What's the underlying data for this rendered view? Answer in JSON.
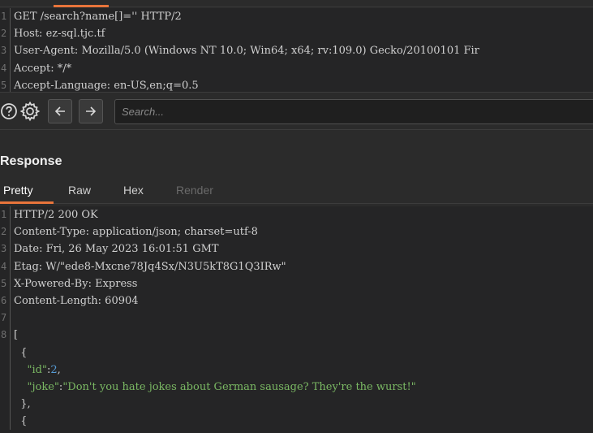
{
  "request": {
    "lines": [
      {
        "n": "1",
        "segments": [
          {
            "t": "GET /search?name[]='' HTTP/2",
            "c": ""
          }
        ]
      },
      {
        "n": "2",
        "segments": [
          {
            "t": "Host: ez-sql.tjc.tf",
            "c": ""
          }
        ]
      },
      {
        "n": "3",
        "segments": [
          {
            "t": "User-Agent: Mozilla/5.0 (Windows NT 10.0; Win64; x64; rv:109.0) Gecko/20100101 Fir",
            "c": ""
          }
        ]
      },
      {
        "n": "4",
        "segments": [
          {
            "t": "Accept: */*",
            "c": ""
          }
        ]
      },
      {
        "n": "5",
        "segments": [
          {
            "t": "Accept-Language: en-US,en;q=0.5",
            "c": ""
          }
        ]
      }
    ]
  },
  "toolbar": {
    "search_placeholder": "Search..."
  },
  "response": {
    "title": "Response",
    "tabs": [
      {
        "label": "Pretty",
        "state": "active"
      },
      {
        "label": "Raw",
        "state": "normal"
      },
      {
        "label": "Hex",
        "state": "normal"
      },
      {
        "label": "Render",
        "state": "disabled"
      }
    ],
    "lines": [
      {
        "n": "1",
        "segments": [
          {
            "t": "HTTP/2 200 OK",
            "c": ""
          }
        ]
      },
      {
        "n": "2",
        "segments": [
          {
            "t": "Content-Type: application/json; charset=utf-8",
            "c": ""
          }
        ]
      },
      {
        "n": "3",
        "segments": [
          {
            "t": "Date: Fri, 26 May 2023 16:01:51 GMT",
            "c": ""
          }
        ]
      },
      {
        "n": "4",
        "segments": [
          {
            "t": "Etag: W/\"ede8-Mxcne78Jq4Sx/N3U5kT8G1Q3IRw\"",
            "c": ""
          }
        ]
      },
      {
        "n": "5",
        "segments": [
          {
            "t": "X-Powered-By: Express",
            "c": ""
          }
        ]
      },
      {
        "n": "6",
        "segments": [
          {
            "t": "Content-Length: 60904",
            "c": ""
          }
        ]
      },
      {
        "n": "7",
        "segments": []
      },
      {
        "n": "8",
        "segments": [
          {
            "t": "[",
            "c": ""
          }
        ]
      },
      {
        "n": "",
        "segments": [
          {
            "t": "  {",
            "c": ""
          }
        ]
      },
      {
        "n": "",
        "segments": [
          {
            "t": "    ",
            "c": ""
          },
          {
            "t": "\"id\"",
            "c": "c-green"
          },
          {
            "t": ":",
            "c": ""
          },
          {
            "t": "2",
            "c": "c-blue"
          },
          {
            "t": ",",
            "c": ""
          }
        ]
      },
      {
        "n": "",
        "segments": [
          {
            "t": "    ",
            "c": ""
          },
          {
            "t": "\"joke\"",
            "c": "c-green"
          },
          {
            "t": ":",
            "c": ""
          },
          {
            "t": "\"Don't you hate jokes about German sausage? They're the wurst!\"",
            "c": "c-green"
          }
        ]
      },
      {
        "n": "",
        "segments": [
          {
            "t": "  },",
            "c": ""
          }
        ]
      },
      {
        "n": "",
        "segments": [
          {
            "t": "  {",
            "c": ""
          }
        ]
      }
    ]
  }
}
